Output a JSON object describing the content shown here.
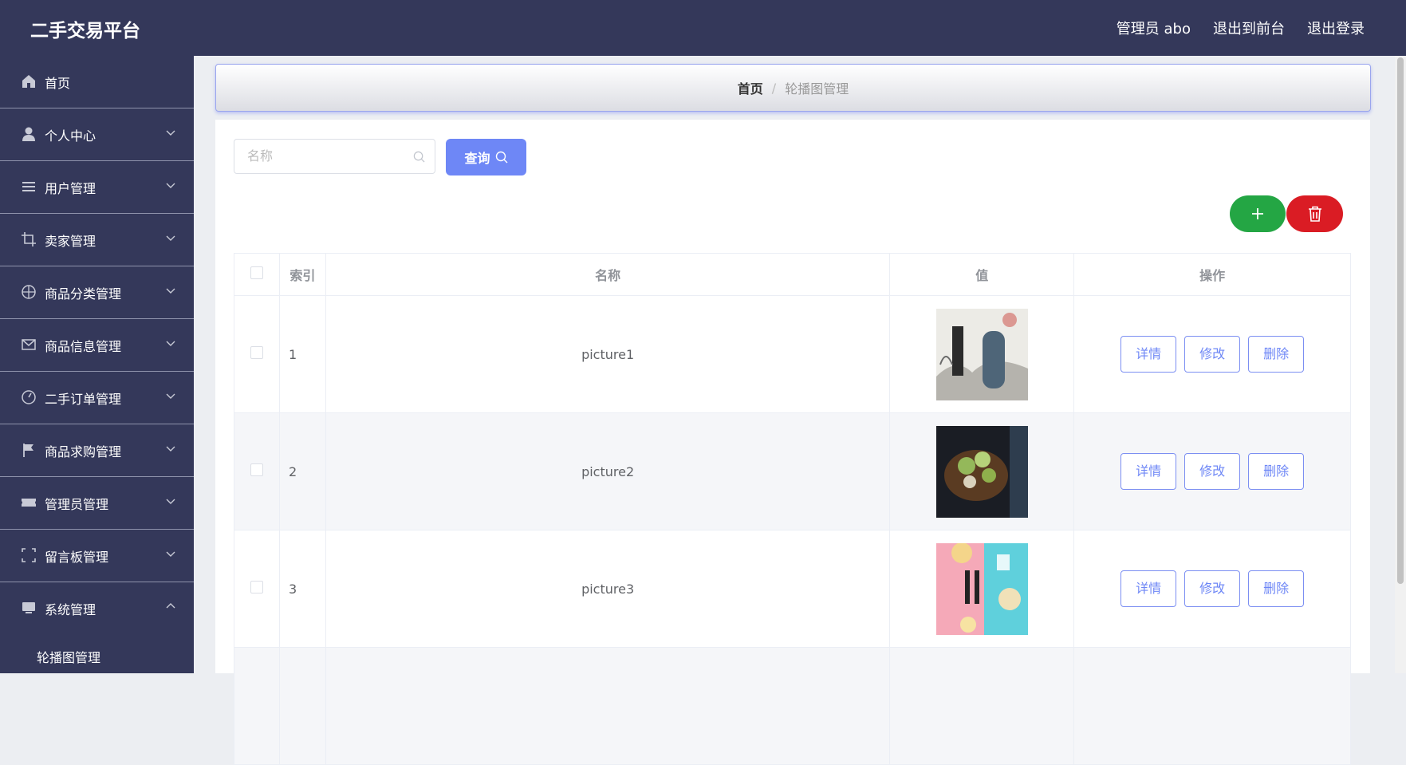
{
  "header": {
    "title": "二手交易平台",
    "admin": "管理员 abo",
    "to_front": "退出到前台",
    "logout": "退出登录"
  },
  "sidebar": {
    "items": [
      {
        "label": "首页",
        "icon": "home-icon",
        "chevron": false
      },
      {
        "label": "个人中心",
        "icon": "user-icon",
        "chevron": true
      },
      {
        "label": "用户管理",
        "icon": "list-icon",
        "chevron": true
      },
      {
        "label": "卖家管理",
        "icon": "crop-icon",
        "chevron": true
      },
      {
        "label": "商品分类管理",
        "icon": "target-icon",
        "chevron": true
      },
      {
        "label": "商品信息管理",
        "icon": "mail-icon",
        "chevron": true
      },
      {
        "label": "二手订单管理",
        "icon": "gauge-icon",
        "chevron": true
      },
      {
        "label": "商品求购管理",
        "icon": "flag-icon",
        "chevron": true
      },
      {
        "label": "管理员管理",
        "icon": "ticket-icon",
        "chevron": true
      },
      {
        "label": "留言板管理",
        "icon": "frame-icon",
        "chevron": true
      },
      {
        "label": "系统管理",
        "icon": "monitor-icon",
        "chevron": true,
        "expanded": true
      }
    ],
    "sub_items": [
      {
        "label": "轮播图管理"
      }
    ]
  },
  "breadcrumb": {
    "home": "首页",
    "sep": "/",
    "current": "轮播图管理"
  },
  "search": {
    "placeholder": "名称",
    "button": "查询"
  },
  "table": {
    "headers": {
      "index": "索引",
      "name": "名称",
      "value": "值",
      "actions": "操作"
    },
    "rows": [
      {
        "index": "1",
        "name": "picture1"
      },
      {
        "index": "2",
        "name": "picture2"
      },
      {
        "index": "3",
        "name": "picture3"
      }
    ],
    "actions": {
      "detail": "详情",
      "edit": "修改",
      "delete": "删除"
    }
  },
  "colors": {
    "header_bg": "#34385a",
    "primary": "#6e87f6",
    "add": "#24a644",
    "danger": "#da1c24"
  }
}
